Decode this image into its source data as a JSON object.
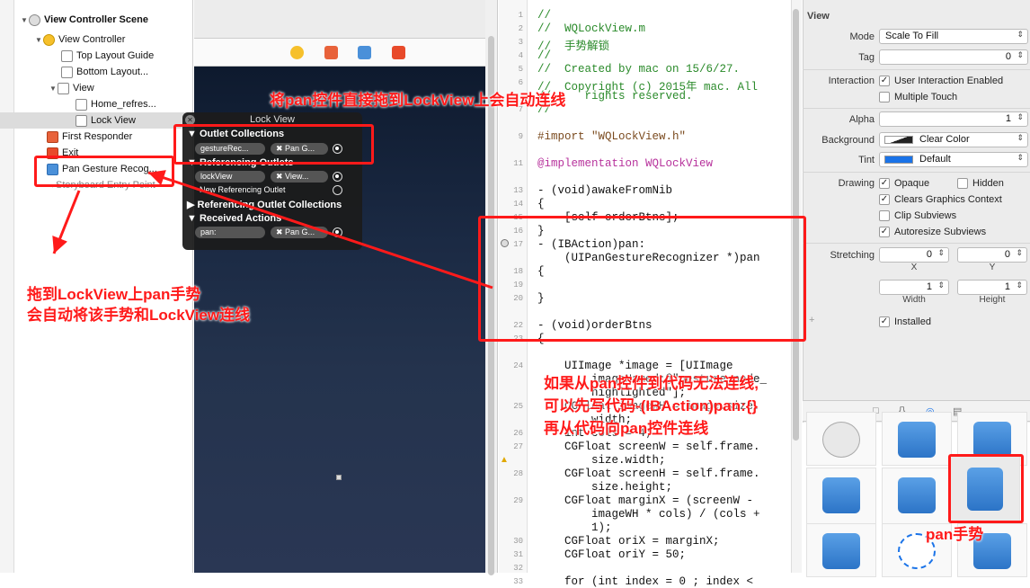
{
  "outline": {
    "rows": [
      {
        "label": "View Controller Scene"
      },
      {
        "label": "View Controller"
      },
      {
        "label": "Top Layout Guide"
      },
      {
        "label": "Bottom Layout..."
      },
      {
        "label": "View"
      },
      {
        "label": "Home_refres..."
      },
      {
        "label": "Lock View"
      },
      {
        "label": "First Responder"
      },
      {
        "label": "Exit"
      },
      {
        "label": "Pan Gesture Recog..."
      },
      {
        "label": "Storyboard Entry Point"
      }
    ]
  },
  "popup": {
    "title": "Lock View",
    "sec_outlet_collections": "Outlet Collections",
    "oc_left": "gestureRec...",
    "oc_right": "Pan G...",
    "sec_referencing_outlets": "Referencing Outlets",
    "ro_left": "lockView",
    "ro_right": "View...",
    "new_ref_outlet": "New Referencing Outlet",
    "sec_ref_outlet_collections": "Referencing Outlet Collections",
    "sec_received_actions": "Received Actions",
    "ra_left": "pan:",
    "ra_right": "Pan G..."
  },
  "code": {
    "lines": [
      {
        "n": "1",
        "t": "//"
      },
      {
        "n": "2",
        "t": "//  WQLockView.m"
      },
      {
        "n": "3",
        "t": "//  手势解锁"
      },
      {
        "n": "4",
        "t": "//"
      },
      {
        "n": "5",
        "t": "//  Created by mac on 15/6/27."
      },
      {
        "n": "6",
        "t": "//  Copyright (c) 2015年 mac. All"
      },
      {
        "n": "",
        "t": "//     rights reserved."
      },
      {
        "n": "7",
        "t": "//"
      },
      {
        "n": "9",
        "t": "#import \"WQLockView.h\""
      },
      {
        "n": "11",
        "t": "@implementation WQLockView"
      },
      {
        "n": "13",
        "t": "- (void)awakeFromNib"
      },
      {
        "n": "14",
        "t": "{"
      },
      {
        "n": "15",
        "t": "    [self orderBtns];"
      },
      {
        "n": "16",
        "t": "}"
      },
      {
        "n": "17",
        "t": "- (IBAction)pan:"
      },
      {
        "n": "",
        "t": "    (UIPanGestureRecognizer *)pan"
      },
      {
        "n": "18",
        "t": "{"
      },
      {
        "n": "19",
        "t": ""
      },
      {
        "n": "20",
        "t": "}"
      },
      {
        "n": "22",
        "t": "- (void)orderBtns"
      },
      {
        "n": "23",
        "t": "{"
      },
      {
        "n": "24",
        "t": "    UIImage *image = [UIImage"
      },
      {
        "n": "",
        "t": "        imageNamed:@\"gesture_node_"
      },
      {
        "n": "",
        "t": "        highlighted\"];"
      },
      {
        "n": "25",
        "t": "    CGFloat imageWH = image.size."
      },
      {
        "n": "",
        "t": "        width;"
      },
      {
        "n": "26",
        "t": "    int cols = 4;"
      },
      {
        "n": "27",
        "t": "    CGFloat screenW = self.frame."
      },
      {
        "n": "",
        "t": "        size.width;"
      },
      {
        "n": "28",
        "t": "    CGFloat screenH = self.frame."
      },
      {
        "n": "",
        "t": "        size.height;"
      },
      {
        "n": "29",
        "t": "    CGFloat marginX = (screenW -"
      },
      {
        "n": "",
        "t": "        imageWH * cols) / (cols +"
      },
      {
        "n": "",
        "t": "        1);"
      },
      {
        "n": "30",
        "t": "    CGFloat oriX = marginX;"
      },
      {
        "n": "31",
        "t": "    CGFloat oriY = 50;"
      },
      {
        "n": "32",
        "t": ""
      },
      {
        "n": "33",
        "t": "    for (int index = 0 ; index <"
      }
    ]
  },
  "inspector": {
    "section": "View",
    "mode_label": "Mode",
    "mode_value": "Scale To Fill",
    "tag_label": "Tag",
    "tag_value": "0",
    "interaction_label": "Interaction",
    "user_interaction": "User Interaction Enabled",
    "multiple_touch": "Multiple Touch",
    "alpha_label": "Alpha",
    "alpha_value": "1",
    "background_label": "Background",
    "background_value": "Clear Color",
    "tint_label": "Tint",
    "tint_value": "Default",
    "drawing_label": "Drawing",
    "opaque": "Opaque",
    "hidden": "Hidden",
    "clears_graphics": "Clears Graphics Context",
    "clip_subviews": "Clip Subviews",
    "autoresize": "Autoresize Subviews",
    "stretching_label": "Stretching",
    "stretch_x": "0",
    "stretch_y": "0",
    "stretch_w": "1",
    "stretch_h": "1",
    "x_label": "X",
    "y_label": "Y",
    "width_label": "Width",
    "height_label": "Height",
    "installed": "Installed",
    "tint_color": "#1a73e8"
  },
  "library": {
    "tabs": [
      "□",
      "{}",
      "◎",
      "▤"
    ]
  },
  "annotations": {
    "top": "将pan控件直接拖到LockView上会自动连线",
    "left_1": "拖到LockView上pan手势",
    "left_2": "会自动将该手势和LockView连线",
    "right_1": "如果从pan控件到代码无法连线,",
    "right_2": "可以先写代码-(IBAction)pan:{}",
    "right_3": "再从代码向pan控件连线",
    "pan": "pan手势",
    "color": "#ff1a1a"
  }
}
